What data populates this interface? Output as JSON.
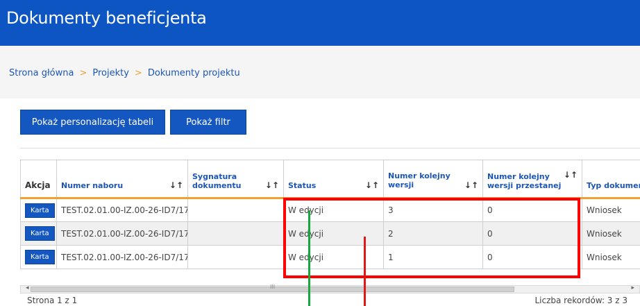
{
  "header": {
    "title": "Dokumenty beneficjenta"
  },
  "breadcrumb": {
    "items": [
      "Strona główna",
      "Projekty",
      "Dokumenty projektu"
    ],
    "separator": ">"
  },
  "toolbar": {
    "personalize_label": "Pokaż personalizację tabeli",
    "filter_label": "Pokaż filtr"
  },
  "table": {
    "columns": [
      "Akcja",
      "Numer naboru",
      "Sygnatura dokumentu",
      "Status",
      "Numer kolejny wersji",
      "Numer kolejny wersji przestanej",
      "Typ dokumentu"
    ],
    "sort_icon": "↓↑",
    "rows": [
      {
        "action": "Karta",
        "numer_naboru": "TEST.02.01.00-IZ.00-26-ID7/17",
        "sygnatura": "",
        "status": "W edycji",
        "numer_wersji": "3",
        "numer_wersji_przestanej": "0",
        "typ": "Wniosek"
      },
      {
        "action": "Karta",
        "numer_naboru": "TEST.02.01.00-IZ.00-26-ID7/17",
        "sygnatura": "",
        "status": "W edycji",
        "numer_wersji": "2",
        "numer_wersji_przestanej": "0",
        "typ": "Wniosek"
      },
      {
        "action": "Karta",
        "numer_naboru": "TEST.02.01.00-IZ.00-26-ID7/17",
        "sygnatura": "",
        "status": "W edycji",
        "numer_wersji": "1",
        "numer_wersji_przestanej": "0",
        "typ": "Wniosek"
      }
    ]
  },
  "scrollbar": {
    "left_arrow": "◂",
    "right_arrow": "▸",
    "grip": "III"
  },
  "footer": {
    "page_info": "Strona 1 z 1",
    "records_info": "Liczba rekordów: 3 z 3"
  },
  "colors": {
    "header_bg": "#0d55c3",
    "button_bg": "#1557c0",
    "sort_underline": "#f0a030",
    "highlight_box": "#ff0000",
    "annotation_green": "#16a83a",
    "annotation_red": "#e01818"
  }
}
